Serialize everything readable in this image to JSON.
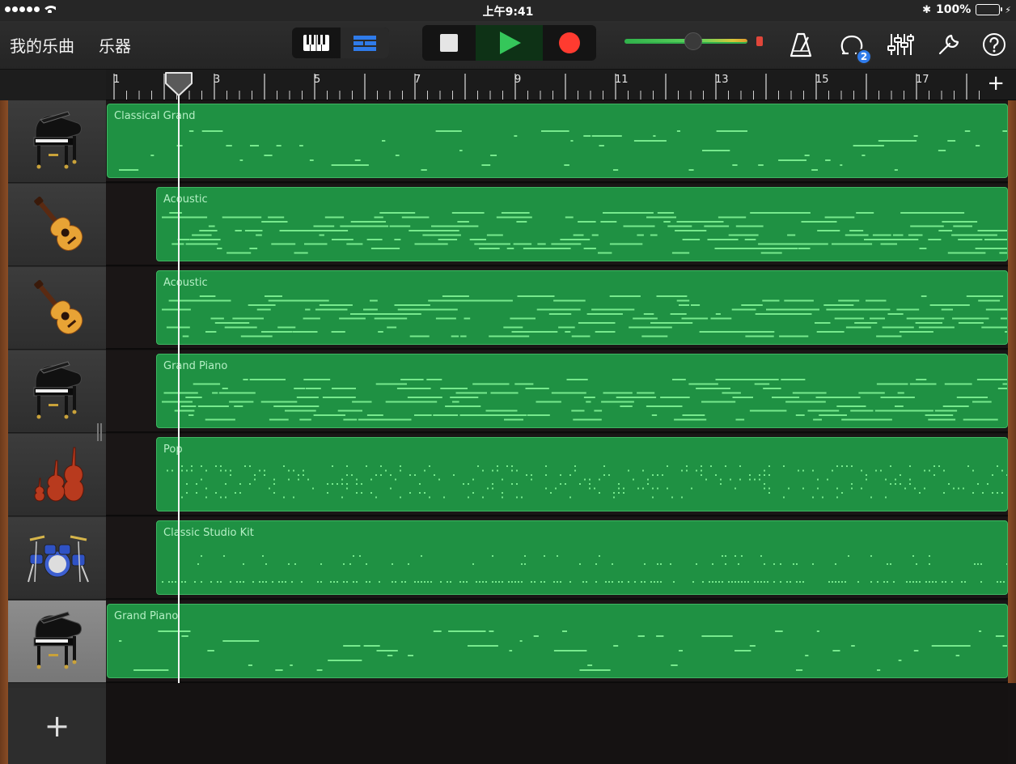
{
  "status_bar": {
    "time": "上午9:41",
    "battery_text": "100%"
  },
  "toolbar": {
    "my_songs": "我的乐曲",
    "instruments": "乐器",
    "loop_badge": "2",
    "icons": [
      "keyboard-view-icon",
      "tracks-view-icon",
      "stop-icon",
      "play-icon",
      "record-icon",
      "metronome-icon",
      "loop-browser-icon",
      "mixer-icon",
      "settings-wrench-icon",
      "help-icon"
    ]
  },
  "ruler": {
    "bars": [
      "1",
      "3",
      "5",
      "7",
      "9",
      "11",
      "13",
      "15",
      "17"
    ],
    "add_label": "+"
  },
  "colors": {
    "region_fill": "#1f9143",
    "region_border": "#3fb562",
    "note": "#77e98d",
    "play": "#35c75a",
    "record": "#ff3b30",
    "badge": "#2f7bea"
  },
  "tracks": [
    {
      "instrument": "grand-piano-icon",
      "region": "Classical Grand",
      "style": "sparse"
    },
    {
      "instrument": "acoustic-guitar-icon",
      "region": "Acoustic",
      "style": "dense"
    },
    {
      "instrument": "acoustic-guitar-icon",
      "region": "Acoustic",
      "style": "dense"
    },
    {
      "instrument": "grand-piano-icon",
      "region": "Grand Piano",
      "style": "dense"
    },
    {
      "instrument": "strings-icon",
      "region": "Pop",
      "style": "dots"
    },
    {
      "instrument": "drum-kit-icon",
      "region": "Classic Studio Kit",
      "style": "drums"
    },
    {
      "instrument": "grand-piano-icon",
      "region": "Grand Piano",
      "style": "sparse",
      "selected": true
    }
  ],
  "add_track_label": "+"
}
